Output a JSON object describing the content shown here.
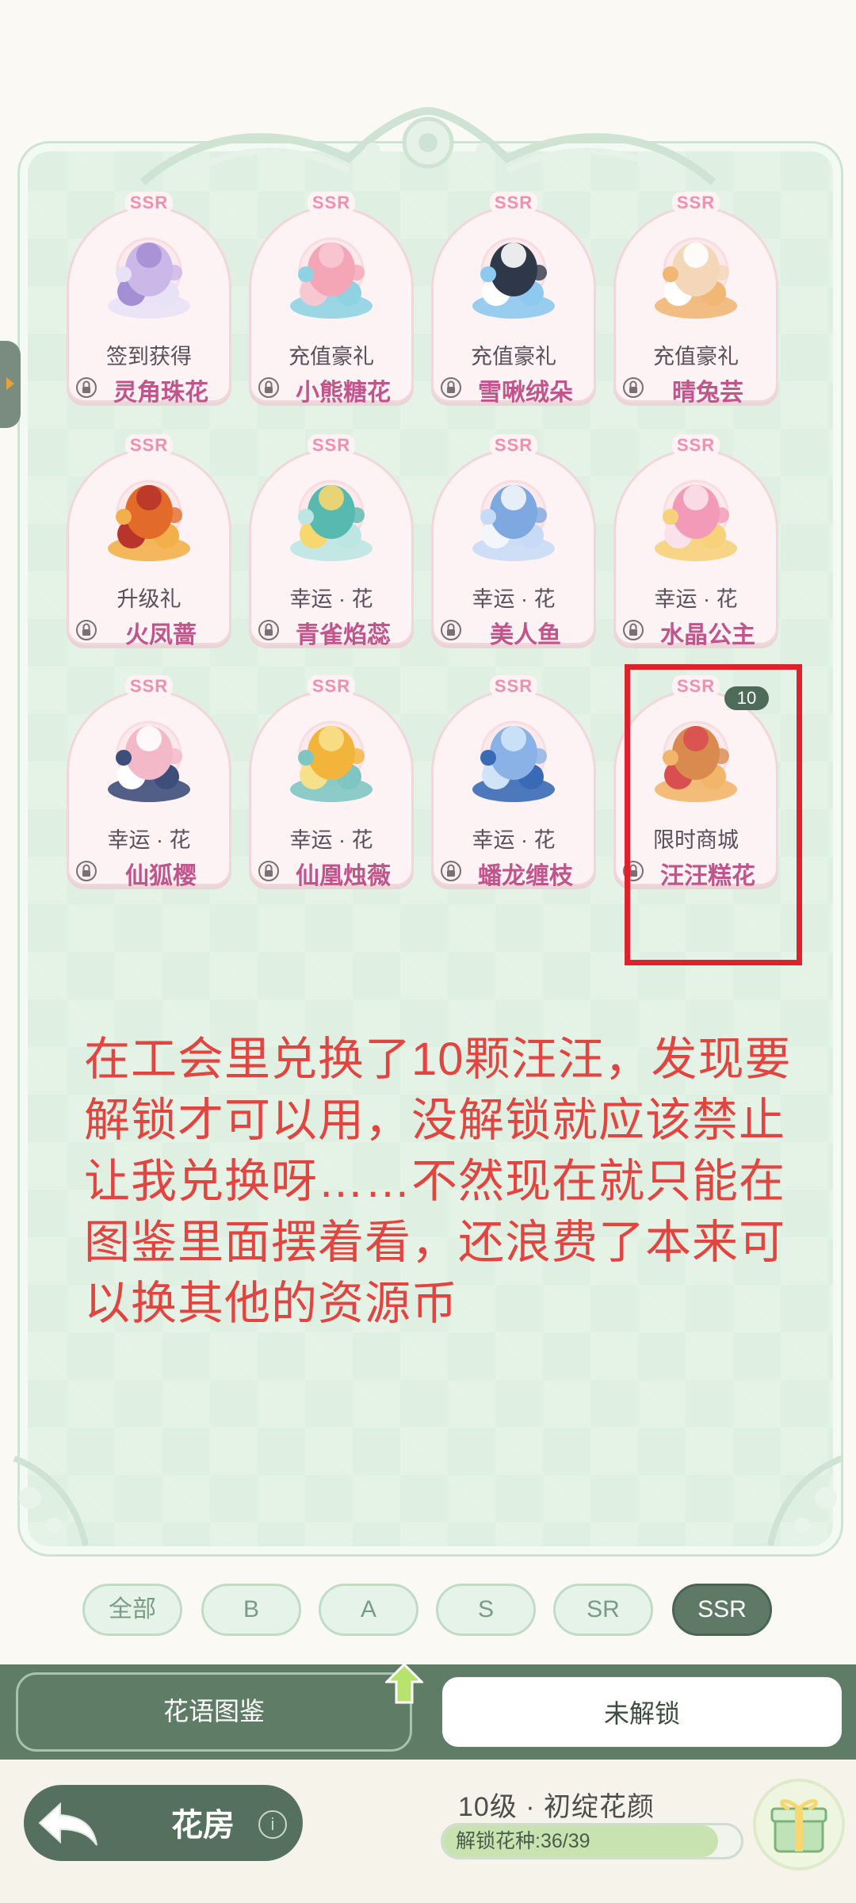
{
  "cards": [
    {
      "rarity": "SSR",
      "source": "签到获得",
      "name": "灵角珠花",
      "colors": [
        "#cbb7e8",
        "#e8e2f6",
        "#a58fd4"
      ]
    },
    {
      "rarity": "SSR",
      "source": "充值豪礼",
      "name": "小熊糖花",
      "colors": [
        "#f4a6b6",
        "#8fd3e2",
        "#f8c8d2"
      ]
    },
    {
      "rarity": "SSR",
      "source": "充值豪礼",
      "name": "雪啾绒朵",
      "colors": [
        "#2f3848",
        "#8ec9ef",
        "#ffffff"
      ]
    },
    {
      "rarity": "SSR",
      "source": "充值豪礼",
      "name": "晴兔芸",
      "colors": [
        "#f3d7b8",
        "#f0b775",
        "#ffffff"
      ]
    },
    {
      "rarity": "SSR",
      "source": "升级礼",
      "name": "火凤蔷",
      "colors": [
        "#e36b2a",
        "#f3b04a",
        "#b8352b"
      ]
    },
    {
      "rarity": "SSR",
      "source": "幸运 · 花",
      "name": "青雀焰蕊",
      "colors": [
        "#57b9b0",
        "#bde5e2",
        "#f6d770"
      ]
    },
    {
      "rarity": "SSR",
      "source": "幸运 · 花",
      "name": "美人鱼",
      "colors": [
        "#7ea8e0",
        "#c8dbf6",
        "#f2f6fb"
      ]
    },
    {
      "rarity": "SSR",
      "source": "幸运 · 花",
      "name": "水晶公主",
      "colors": [
        "#f29ab8",
        "#f7d27a",
        "#fbe1ea"
      ]
    },
    {
      "rarity": "SSR",
      "source": "幸运 · 花",
      "name": "仙狐樱",
      "colors": [
        "#f3b9c9",
        "#3e4e7a",
        "#ffffff"
      ]
    },
    {
      "rarity": "SSR",
      "source": "幸运 · 花",
      "name": "仙凰烛薇",
      "colors": [
        "#f3b43b",
        "#7fc6c2",
        "#f7e08c"
      ]
    },
    {
      "rarity": "SSR",
      "source": "幸运 · 花",
      "name": "蟠龙缠枝",
      "colors": [
        "#8ab2e6",
        "#3a6ab6",
        "#cfe5f7"
      ]
    },
    {
      "rarity": "SSR",
      "source": "限时商城",
      "name": "汪汪糕花",
      "count": "10",
      "colors": [
        "#d98b4f",
        "#f2b66a",
        "#d94f4f"
      ]
    }
  ],
  "annotation": "在工会里兑换了10颗汪汪，发现要解锁才可以用，没解锁就应该禁止让我兑换呀……不然现在就只能在图鉴里面摆着看，还浪费了本来可以换其他的资源币",
  "filters": [
    {
      "label": "全部",
      "active": false
    },
    {
      "label": "B",
      "active": false
    },
    {
      "label": "A",
      "active": false
    },
    {
      "label": "S",
      "active": false
    },
    {
      "label": "SR",
      "active": false
    },
    {
      "label": "SSR",
      "active": true
    }
  ],
  "tabs": {
    "left": "花语图鉴",
    "right": "未解锁"
  },
  "footer": {
    "home": "花房",
    "info": "i",
    "level": "10级 · 初绽花颜",
    "progress_text": "解锁花种:36/39",
    "progress_value": 0.923
  },
  "icons": [
    "lock-icon",
    "back-arrow-icon",
    "info-icon",
    "gift-icon",
    "up-arrow-icon"
  ],
  "colors": {
    "panel": "#dff0e2",
    "accent_dark": "#5f7c66",
    "rarity_text": "#f08fb0",
    "name_text": "#c1548b",
    "annotation": "#e34440",
    "highlight": "#e0202a"
  }
}
